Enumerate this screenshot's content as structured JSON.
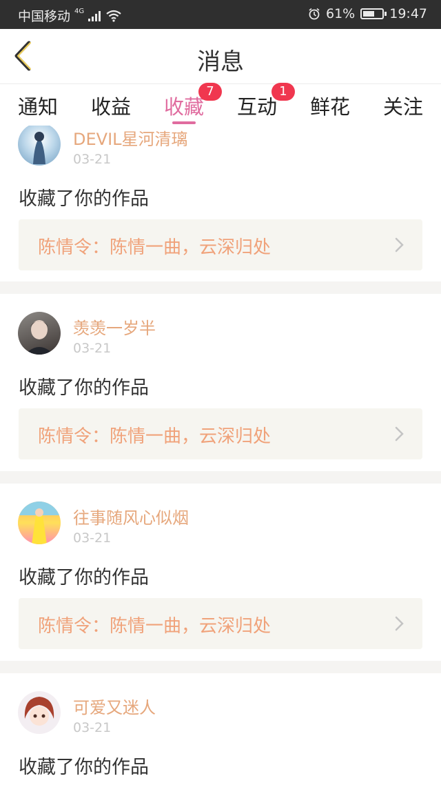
{
  "status_bar": {
    "carrier": "中国移动",
    "network": "4G",
    "battery_percent": "61%",
    "battery_level": 0.61,
    "time": "19:47"
  },
  "nav": {
    "title": "消息",
    "back_icon": "back-chevron-icon"
  },
  "tabs": [
    {
      "label": "通知",
      "badge": ""
    },
    {
      "label": "收益",
      "badge": ""
    },
    {
      "label": "收藏",
      "badge": "7",
      "active": true
    },
    {
      "label": "互动",
      "badge": "1"
    },
    {
      "label": "鲜花",
      "badge": ""
    },
    {
      "label": "关注",
      "badge": ""
    }
  ],
  "colors": {
    "accent": "#e06c9f",
    "badge": "#f0374f",
    "username": "#e6a77c",
    "work_title": "#f0a27a"
  },
  "cards": [
    {
      "user": "DEVIL星河清璃",
      "date": "03-21",
      "action": "收藏了你的作品",
      "work": "陈情令：陈情一曲，云深归处"
    },
    {
      "user": "羡羡一岁半",
      "date": "03-21",
      "action": "收藏了你的作品",
      "work": "陈情令：陈情一曲，云深归处"
    },
    {
      "user": "往事随风心似烟",
      "date": "03-21",
      "action": "收藏了你的作品",
      "work": "陈情令：陈情一曲，云深归处"
    },
    {
      "user": "可爱又迷人",
      "date": "03-21",
      "action": "收藏了你的作品",
      "work": ""
    }
  ]
}
